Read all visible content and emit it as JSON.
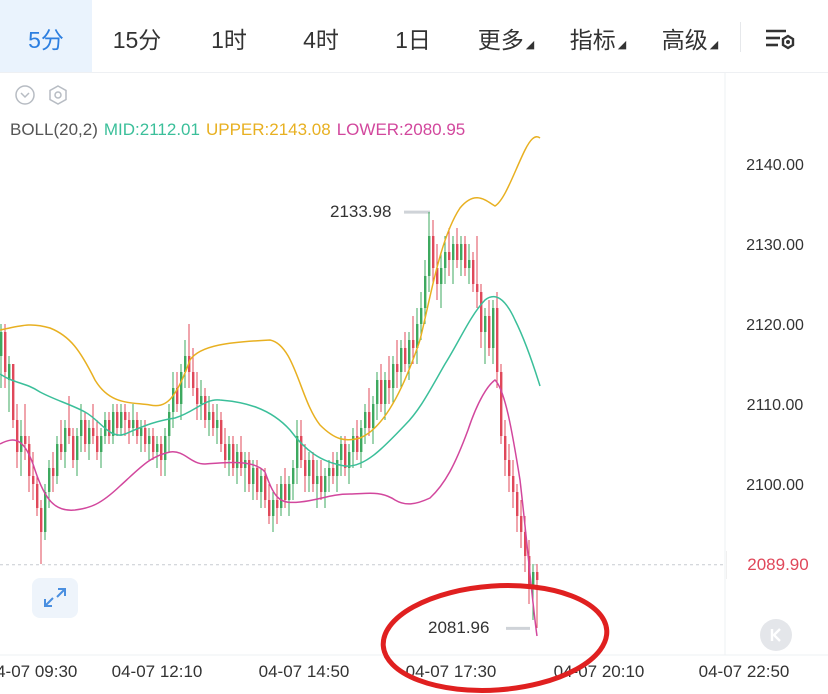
{
  "tabs": [
    {
      "label": "5分",
      "active": true
    },
    {
      "label": "15分",
      "active": false
    },
    {
      "label": "1时",
      "active": false
    },
    {
      "label": "4时",
      "active": false
    },
    {
      "label": "1日",
      "active": false
    },
    {
      "label": "更多",
      "active": false,
      "dropdown": true
    },
    {
      "label": "指标",
      "active": false,
      "dropdown": true
    },
    {
      "label": "高级",
      "active": false,
      "dropdown": true
    }
  ],
  "indicator": {
    "name": "BOLL(20,2)",
    "mid": "MID:2112.01",
    "upper": "UPPER:2143.08",
    "lower": "LOWER:2080.95"
  },
  "colors": {
    "accent": "#2d7fe0",
    "mid": "#3bbf9a",
    "upper": "#e8b021",
    "lower": "#d2479d",
    "up_candle": "#3da95f",
    "down_candle": "#e0485a",
    "price_tag": "#e0485a"
  },
  "icons": {
    "collapse": "chevron-down-circle-icon",
    "settings": "hexagon-gear-icon",
    "chart_settings": "chart-settings-icon",
    "expand": "expand-arrows-icon",
    "back": "skip-back-icon"
  },
  "price_axis": [
    "2140.00",
    "2130.00",
    "2120.00",
    "2110.00",
    "2100.00"
  ],
  "time_axis": [
    "04-07 09:30",
    "04-07 12:10",
    "04-07 14:50",
    "04-07 17:30",
    "04-07 20:10",
    "04-07 22:50"
  ],
  "current_price": "2089.90",
  "high_label": "2133.98",
  "low_label": "2081.96"
}
